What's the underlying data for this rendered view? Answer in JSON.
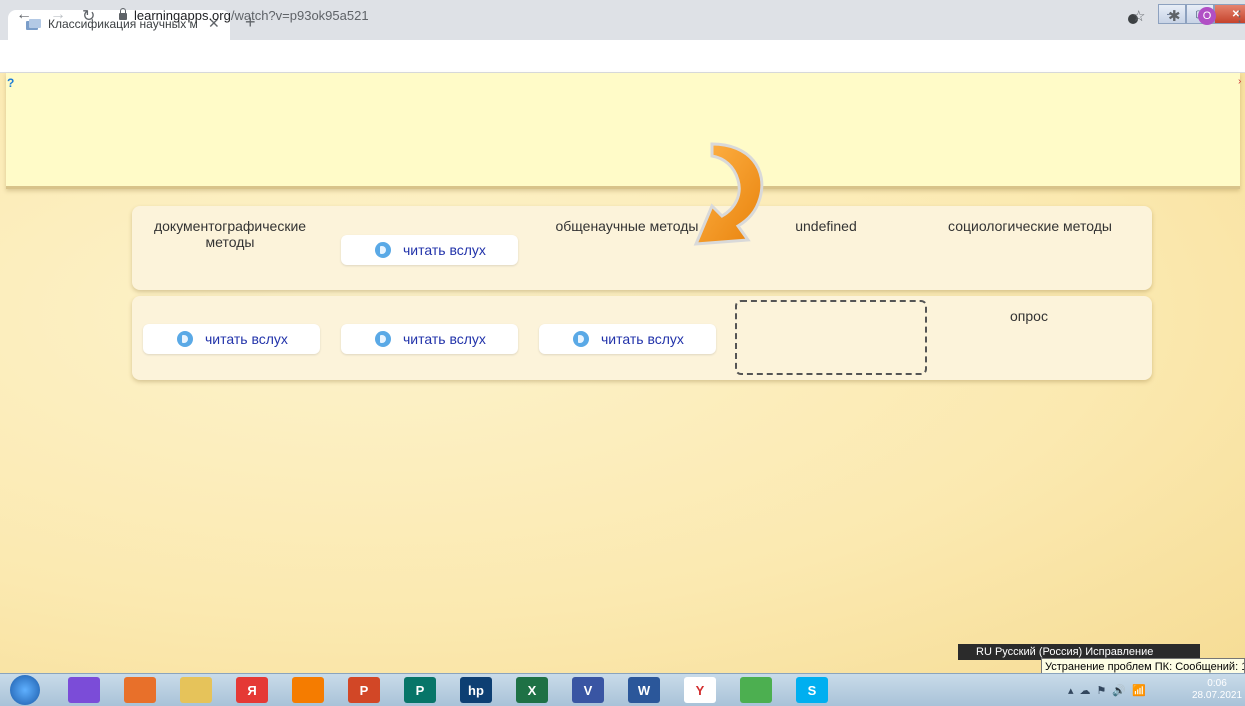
{
  "browser": {
    "tab_title": "Классификация научных метод",
    "tab_close": "✕",
    "new_tab": "+",
    "url_host": "learningapps.org",
    "url_path": "/watch?v=p93ok95a521",
    "avatar_letter": "O"
  },
  "app": {
    "row1": {
      "cell1": "документографические методы",
      "cell2_button": "читать вслух",
      "cell3": "общенаучные методы",
      "cell4": "undefined",
      "cell5": "социологические методы"
    },
    "row2": {
      "cell1_button": "читать вслух",
      "cell2_button": "читать вслух",
      "cell3_button": "читать вслух",
      "cell5": "опрос"
    },
    "arrow_color": "#f39a1e"
  },
  "taskbar": {
    "language_bar": "RU Русский (Россия)   Исправление",
    "tooltip": "Устранение проблем ПК: Сообщений: 1",
    "time": "0:06",
    "date": "28.07.2021",
    "apps": [
      {
        "name": "alice",
        "label": "",
        "color": "#7b4cd8"
      },
      {
        "name": "firefox",
        "label": "",
        "color": "#e8702a"
      },
      {
        "name": "explorer",
        "label": "",
        "color": "#e6c35a"
      },
      {
        "name": "yandex",
        "label": "Я",
        "color": "#e53935"
      },
      {
        "name": "player",
        "label": "",
        "color": "#f57c00"
      },
      {
        "name": "powerpoint",
        "label": "P",
        "color": "#d24726"
      },
      {
        "name": "publisher",
        "label": "P",
        "color": "#077568"
      },
      {
        "name": "hp",
        "label": "hp",
        "color": "#0d3f73"
      },
      {
        "name": "excel",
        "label": "X",
        "color": "#1e7145"
      },
      {
        "name": "visio",
        "label": "V",
        "color": "#3955a3"
      },
      {
        "name": "word",
        "label": "W",
        "color": "#2b579a"
      },
      {
        "name": "yandex-browser",
        "label": "Y",
        "color": "#ffffff"
      },
      {
        "name": "chrome",
        "label": "",
        "color": "#4caf50"
      },
      {
        "name": "skype",
        "label": "S",
        "color": "#00aff0"
      }
    ]
  }
}
